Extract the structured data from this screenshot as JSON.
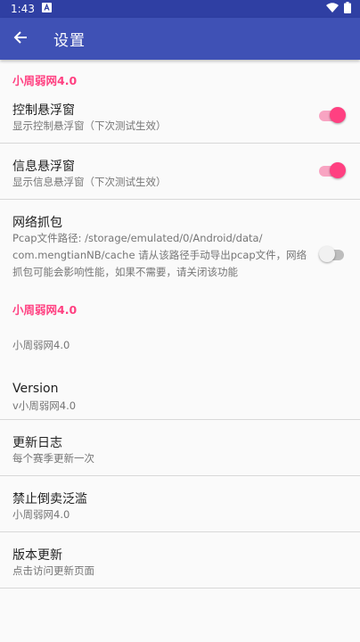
{
  "status_bar": {
    "time": "1:43",
    "notification_icon": "a-box-icon",
    "wifi_icon": "wifi-icon",
    "battery_icon": "battery-icon"
  },
  "app_bar": {
    "back_icon": "arrow-left-icon",
    "title": "设置"
  },
  "colors": {
    "app_bar": "#3f51b5",
    "status_bar": "#2f3fa3",
    "accent": "#ff4081"
  },
  "section1": {
    "header": "小周弱网4.0",
    "control_float": {
      "title": "控制悬浮窗",
      "summary": "显示控制悬浮窗（下次测试生效）",
      "enabled": true
    },
    "info_float": {
      "title": "信息悬浮窗",
      "summary": "显示信息悬浮窗（下次测试生效）",
      "enabled": true
    },
    "packet_capture": {
      "title": "网络抓包",
      "summary_line1": "Pcap文件路径: /storage/emulated/0/Android/data/",
      "summary_line2": "com.mengtianNB/cache 请从该路径手动导出pcap文件，网络",
      "summary_line3": "抓包可能会影响性能，如果不需要，请关闭该功能",
      "enabled": false
    }
  },
  "section2": {
    "header": "小周弱网4.0",
    "app_name": {
      "summary": "小周弱网4.0"
    },
    "version": {
      "title": "Version",
      "summary": "v小周弱网4.0"
    },
    "changelog": {
      "title": "更新日志",
      "summary": "每个赛季更新一次"
    },
    "no_resale": {
      "title": "禁止倒卖泛滥",
      "summary": "小周弱网4.0"
    },
    "update": {
      "title": "版本更新",
      "summary": "点击访问更新页面"
    }
  }
}
